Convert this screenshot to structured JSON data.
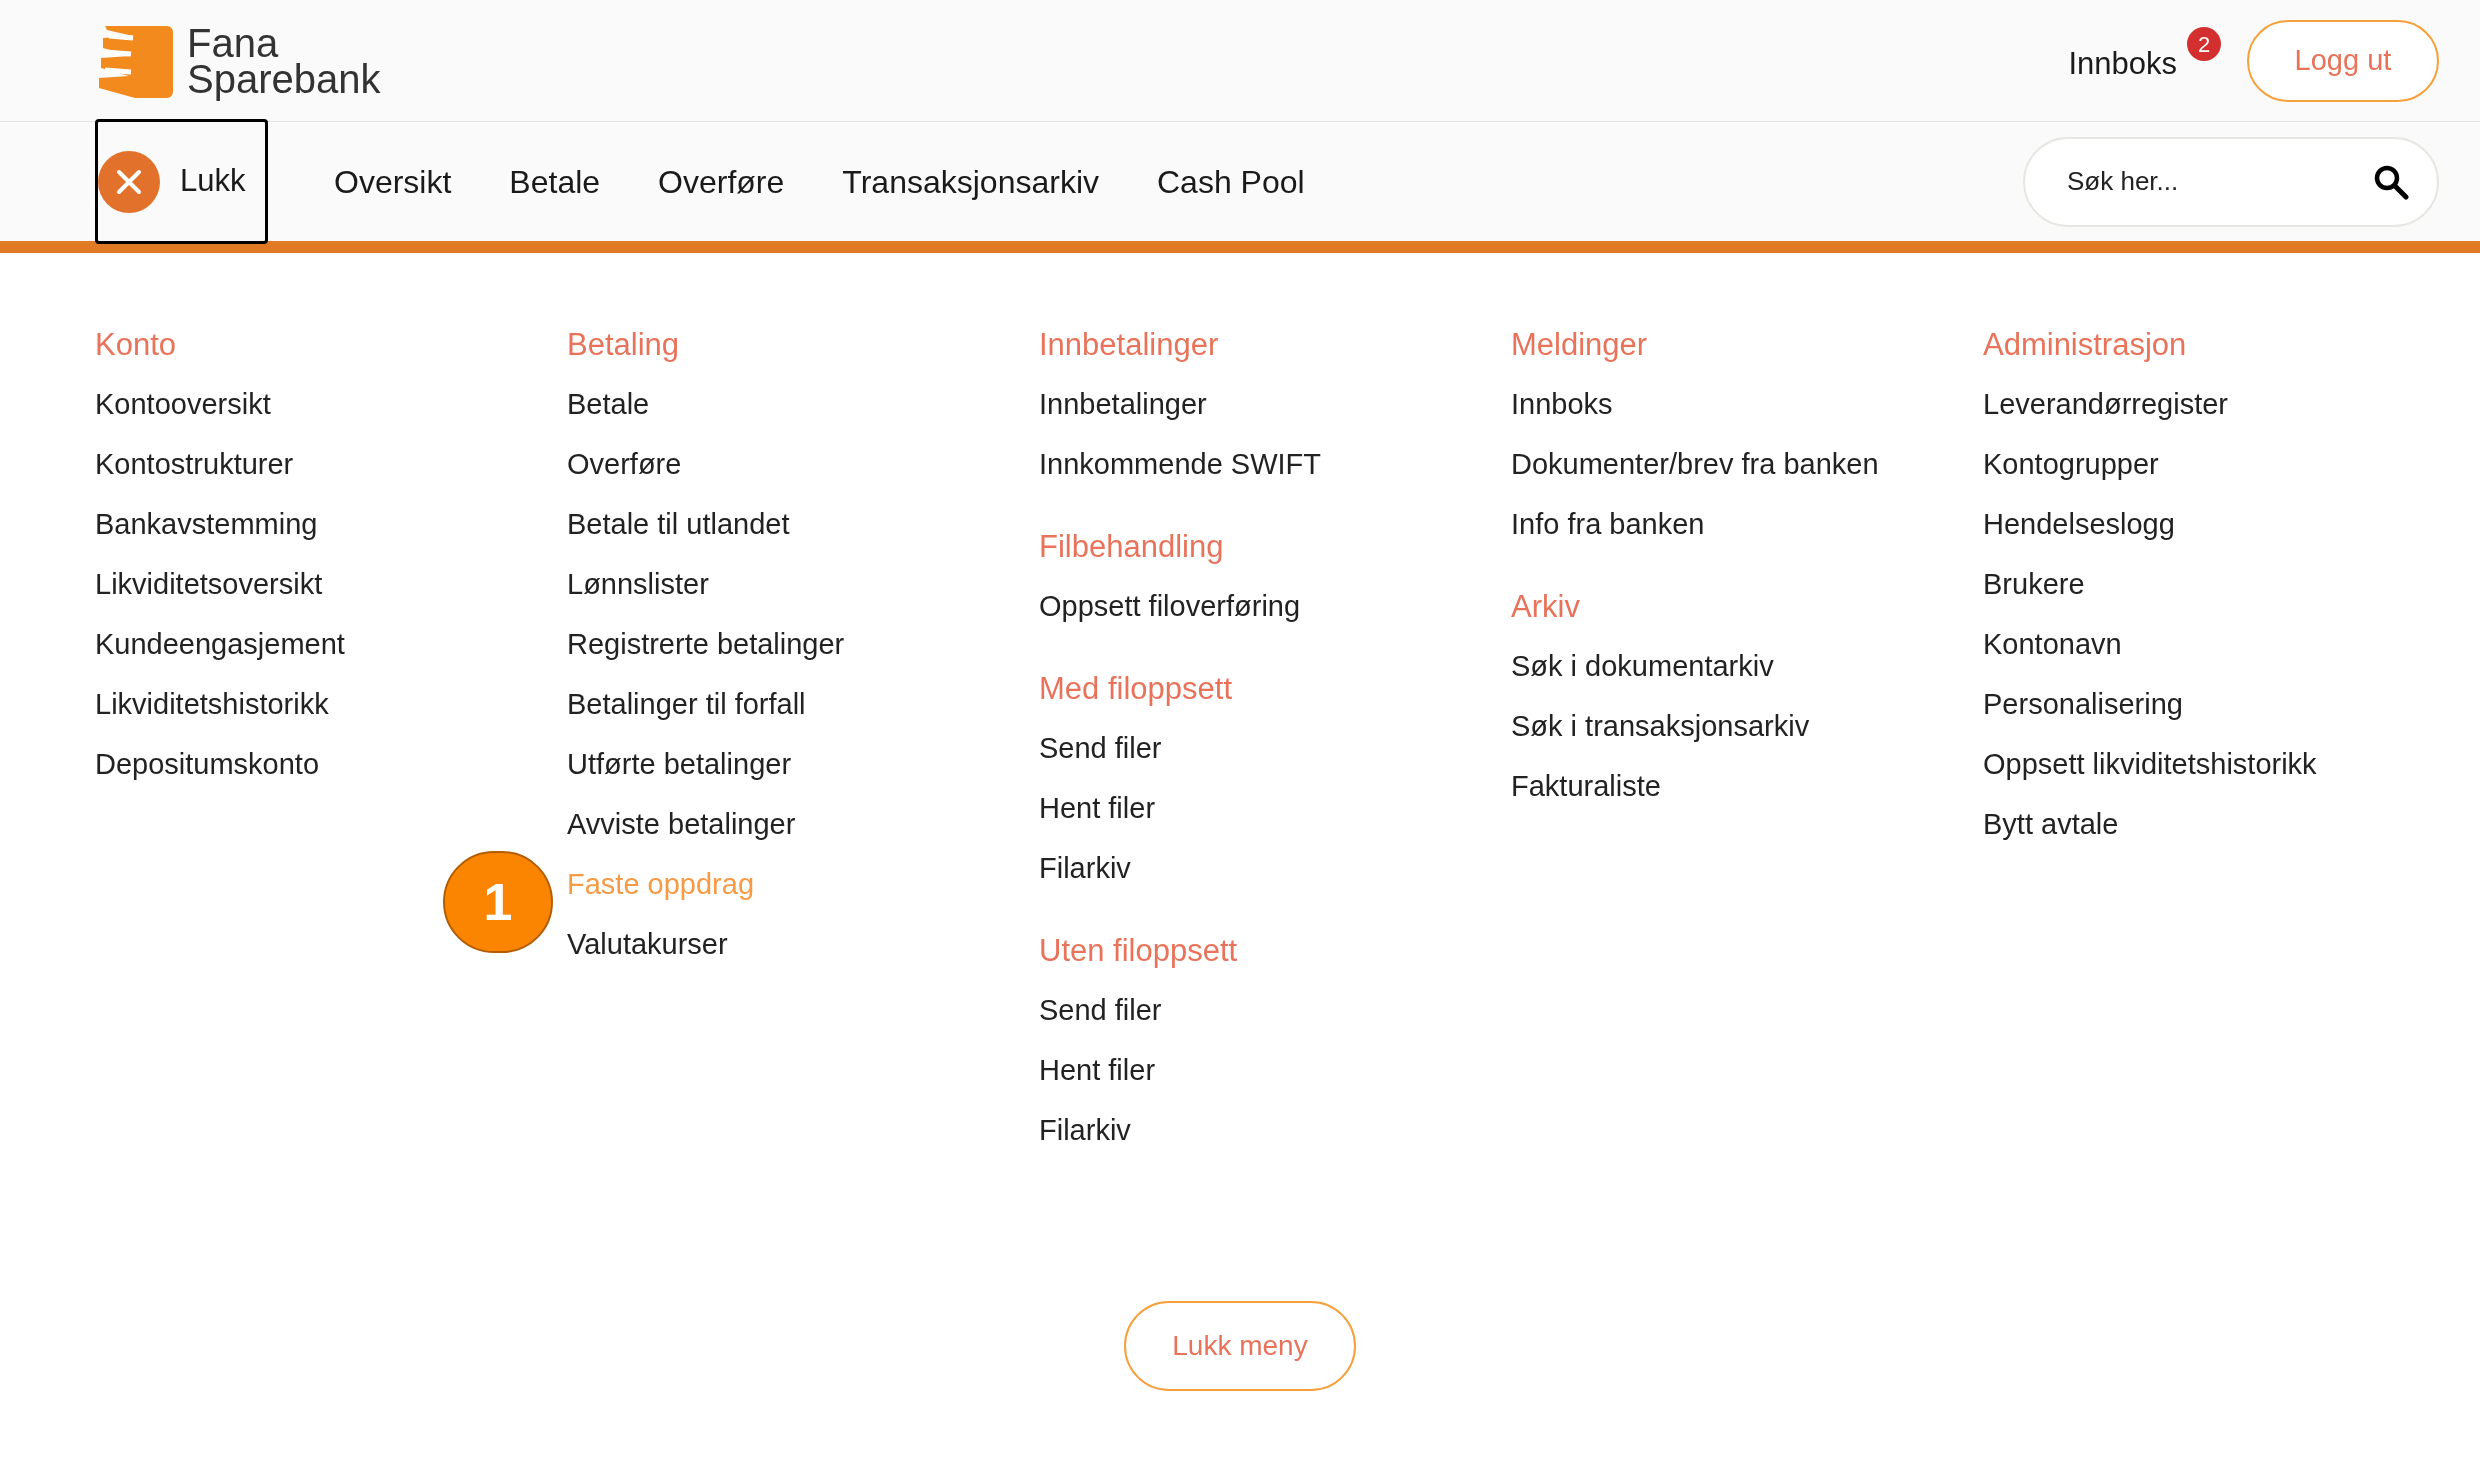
{
  "header": {
    "logo": {
      "line1": "Fana",
      "line2": "Sparebank"
    },
    "inbox": {
      "label": "Innboks",
      "count": "2"
    },
    "logout": "Logg ut"
  },
  "nav": {
    "close": "Lukk",
    "items": [
      "Oversikt",
      "Betale",
      "Overføre",
      "Transaksjonsarkiv",
      "Cash Pool"
    ],
    "search": {
      "placeholder": "Søk her..."
    }
  },
  "menu": {
    "columns": [
      {
        "groups": [
          {
            "heading": "Konto",
            "items": [
              {
                "label": "Kontooversikt",
                "selected": false
              },
              {
                "label": "Kontostrukturer",
                "selected": false
              },
              {
                "label": "Bankavstemming",
                "selected": false
              },
              {
                "label": "Likviditetsoversikt",
                "selected": false
              },
              {
                "label": "Kundeengasjement",
                "selected": false
              },
              {
                "label": "Likviditetshistorikk",
                "selected": false
              },
              {
                "label": "Depositumskonto",
                "selected": false
              }
            ]
          }
        ]
      },
      {
        "groups": [
          {
            "heading": "Betaling",
            "items": [
              {
                "label": "Betale",
                "selected": false
              },
              {
                "label": "Overføre",
                "selected": false
              },
              {
                "label": "Betale til utlandet",
                "selected": false
              },
              {
                "label": "Lønnslister",
                "selected": false
              },
              {
                "label": "Registrerte betalinger",
                "selected": false
              },
              {
                "label": "Betalinger til forfall",
                "selected": false
              },
              {
                "label": "Utførte betalinger",
                "selected": false
              },
              {
                "label": "Avviste betalinger",
                "selected": false
              },
              {
                "label": "Faste oppdrag",
                "selected": true,
                "callout": "1"
              },
              {
                "label": "Valutakurser",
                "selected": false
              }
            ]
          }
        ]
      },
      {
        "groups": [
          {
            "heading": "Innbetalinger",
            "items": [
              {
                "label": "Innbetalinger",
                "selected": false
              },
              {
                "label": "Innkommende SWIFT",
                "selected": false
              }
            ]
          },
          {
            "heading": "Filbehandling",
            "items": [
              {
                "label": "Oppsett filoverføring",
                "selected": false
              }
            ]
          },
          {
            "heading": "Med filoppsett",
            "items": [
              {
                "label": "Send filer",
                "selected": false
              },
              {
                "label": "Hent filer",
                "selected": false
              },
              {
                "label": "Filarkiv",
                "selected": false
              }
            ]
          },
          {
            "heading": "Uten filoppsett",
            "items": [
              {
                "label": "Send filer",
                "selected": false
              },
              {
                "label": "Hent filer",
                "selected": false
              },
              {
                "label": "Filarkiv",
                "selected": false
              }
            ]
          }
        ]
      },
      {
        "groups": [
          {
            "heading": "Meldinger",
            "items": [
              {
                "label": "Innboks",
                "selected": false
              },
              {
                "label": "Dokumenter/brev fra banken",
                "selected": false
              },
              {
                "label": "Info fra banken",
                "selected": false
              }
            ]
          },
          {
            "heading": "Arkiv",
            "items": [
              {
                "label": "Søk i dokumentarkiv",
                "selected": false
              },
              {
                "label": "Søk i transaksjonsarkiv",
                "selected": false
              },
              {
                "label": "Fakturaliste",
                "selected": false
              }
            ]
          }
        ]
      },
      {
        "groups": [
          {
            "heading": "Administrasjon",
            "items": [
              {
                "label": "Leverandørregister",
                "selected": false
              },
              {
                "label": "Kontogrupper",
                "selected": false
              },
              {
                "label": "Hendelseslogg",
                "selected": false
              },
              {
                "label": "Brukere",
                "selected": false
              },
              {
                "label": "Kontonavn",
                "selected": false
              },
              {
                "label": "Personalisering",
                "selected": false
              },
              {
                "label": "Oppsett likviditetshistorikk",
                "selected": false
              },
              {
                "label": "Bytt avtale",
                "selected": false
              }
            ]
          }
        ]
      }
    ],
    "close_button": "Lukk meny"
  }
}
